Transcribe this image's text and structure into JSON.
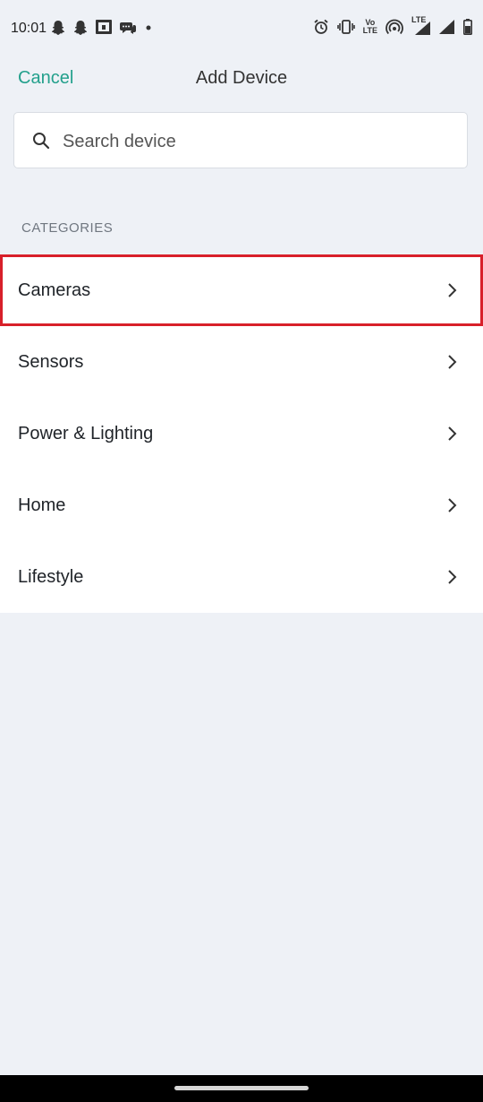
{
  "status_bar": {
    "time": "10:01",
    "left_icons": [
      "snapchat-icon",
      "snapchat-icon",
      "screen-icon",
      "chat-icon",
      "dot-icon"
    ],
    "right_icons": [
      "alarm-icon",
      "vibrate-icon",
      "volte-icon",
      "hotspot-icon",
      "lte-signal-icon",
      "signal-icon",
      "battery-icon"
    ],
    "volte_label": "Vo\nLTE",
    "lte_label": "LTE"
  },
  "header": {
    "cancel_label": "Cancel",
    "title": "Add Device"
  },
  "search": {
    "placeholder": "Search device",
    "value": ""
  },
  "categories": {
    "label": "CATEGORIES",
    "items": [
      {
        "label": "Cameras"
      },
      {
        "label": "Sensors"
      },
      {
        "label": "Power & Lighting"
      },
      {
        "label": "Home"
      },
      {
        "label": "Lifestyle"
      }
    ]
  },
  "colors": {
    "accent": "#23a08c",
    "highlight_border": "#d8202a",
    "background": "#eef1f6"
  }
}
